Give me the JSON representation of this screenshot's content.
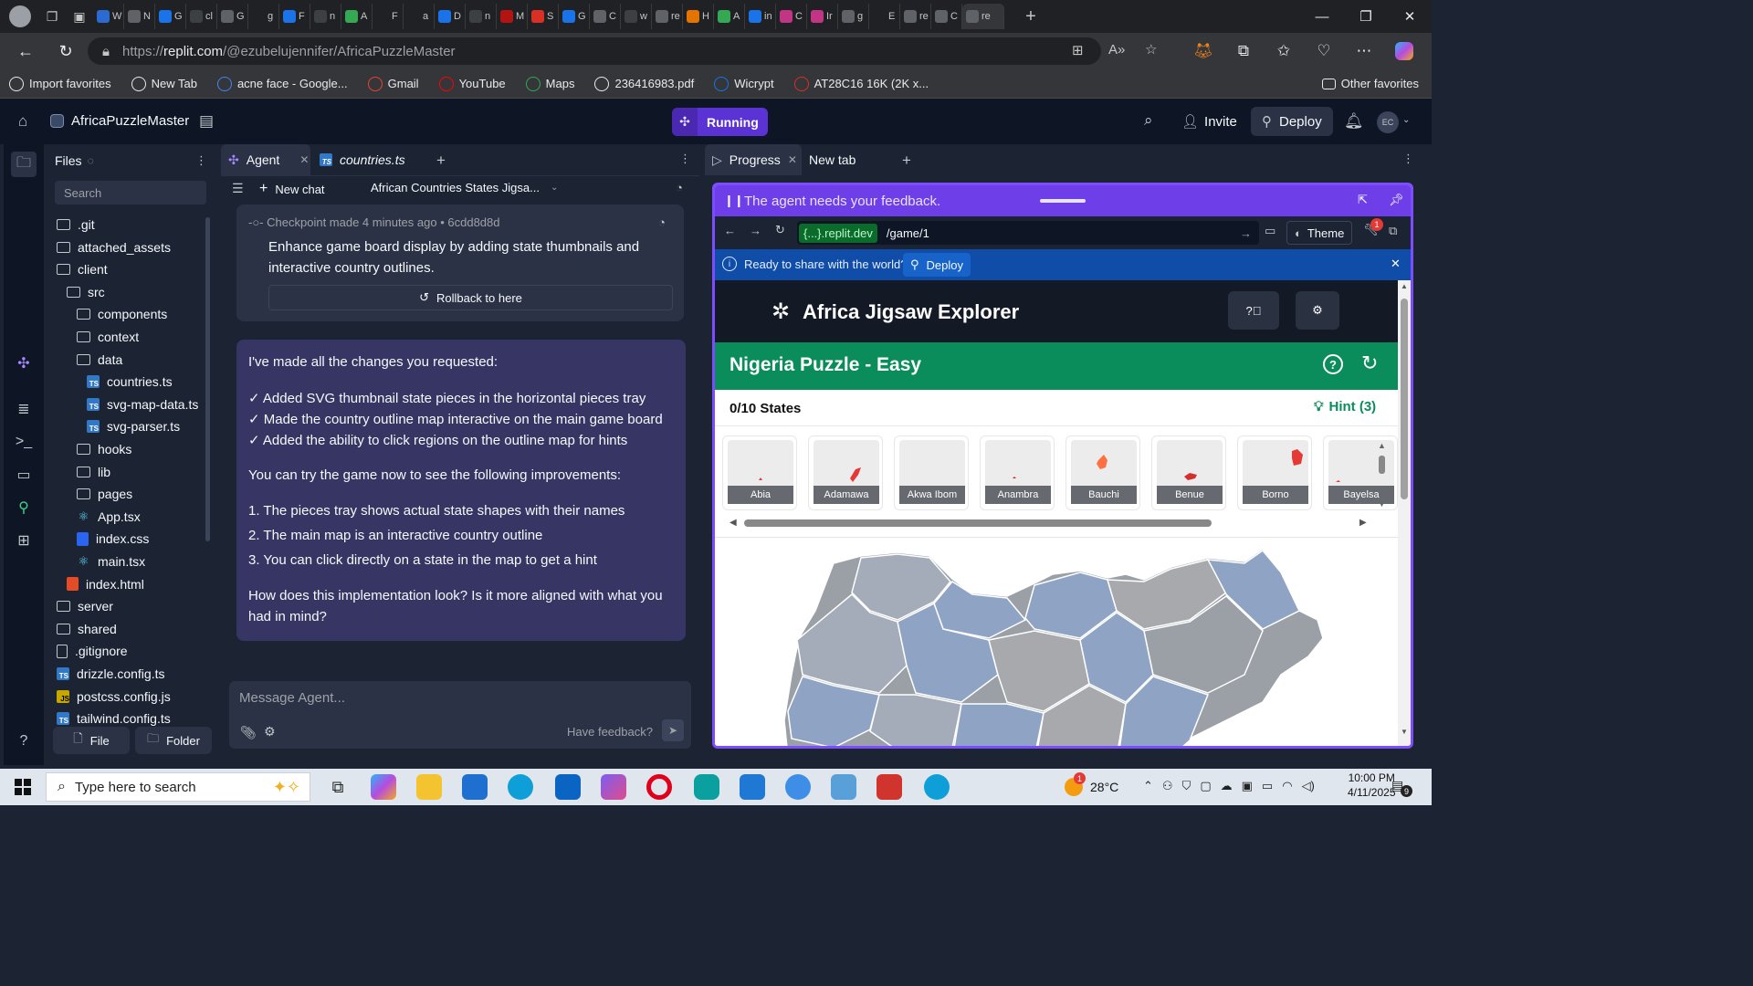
{
  "browser": {
    "tabs": [
      "W",
      "N",
      "G",
      "cl",
      "G",
      "g",
      "F",
      "n",
      "A",
      "F",
      "a",
      "D",
      "n",
      "M",
      "S",
      "G",
      "C",
      "w",
      "re",
      "H",
      "A",
      "in",
      "C",
      "Ir",
      "g",
      "E",
      "re",
      "C",
      "re"
    ],
    "url_prefix": "https://",
    "url_host": "replit.com",
    "url_path": "/@ezubelujennifer/AfricaPuzzleMaster",
    "bookmarks": [
      {
        "label": "Import favorites",
        "icon": "import-icon",
        "color": "#e8eaed"
      },
      {
        "label": "New Tab",
        "icon": "globe-icon",
        "color": "#e8eaed"
      },
      {
        "label": "acne face - Google...",
        "icon": "google-icon",
        "color": "#4285f4"
      },
      {
        "label": "Gmail",
        "icon": "gmail-icon",
        "color": "#ea4335"
      },
      {
        "label": "YouTube",
        "icon": "youtube-icon",
        "color": "#ff0000"
      },
      {
        "label": "Maps",
        "icon": "maps-icon",
        "color": "#34a853"
      },
      {
        "label": "236416983.pdf",
        "icon": "globe-icon",
        "color": "#e8eaed"
      },
      {
        "label": "Wicrypt",
        "icon": "wicrypt-icon",
        "color": "#1a73e8"
      },
      {
        "label": "AT28C16 16K (2K x...",
        "icon": "chip-icon",
        "color": "#d93025"
      }
    ],
    "other_favorites": "Other favorites"
  },
  "replit": {
    "project": "AfricaPuzzleMaster",
    "status": "Running",
    "invite": "Invite",
    "deploy": "Deploy",
    "avatar": "EC"
  },
  "files": {
    "title": "Files",
    "search_placeholder": "Search",
    "items": [
      {
        "name": ".git",
        "type": "folder",
        "depth": 0
      },
      {
        "name": "attached_assets",
        "type": "folder",
        "depth": 0
      },
      {
        "name": "client",
        "type": "folder-open",
        "depth": 0
      },
      {
        "name": "src",
        "type": "folder-open",
        "depth": 1
      },
      {
        "name": "components",
        "type": "folder",
        "depth": 2
      },
      {
        "name": "context",
        "type": "folder",
        "depth": 2
      },
      {
        "name": "data",
        "type": "folder-open",
        "depth": 2
      },
      {
        "name": "countries.ts",
        "type": "ts",
        "depth": 3
      },
      {
        "name": "svg-map-data.ts",
        "type": "ts",
        "depth": 3
      },
      {
        "name": "svg-parser.ts",
        "type": "ts",
        "depth": 3
      },
      {
        "name": "hooks",
        "type": "folder",
        "depth": 2
      },
      {
        "name": "lib",
        "type": "folder",
        "depth": 2
      },
      {
        "name": "pages",
        "type": "folder",
        "depth": 2
      },
      {
        "name": "App.tsx",
        "type": "react",
        "depth": 2
      },
      {
        "name": "index.css",
        "type": "css",
        "depth": 2
      },
      {
        "name": "main.tsx",
        "type": "react",
        "depth": 2
      },
      {
        "name": "index.html",
        "type": "html",
        "depth": 1
      },
      {
        "name": "server",
        "type": "folder",
        "depth": 0
      },
      {
        "name": "shared",
        "type": "folder",
        "depth": 0
      },
      {
        "name": ".gitignore",
        "type": "doc",
        "depth": 0
      },
      {
        "name": "drizzle.config.ts",
        "type": "ts",
        "depth": 0
      },
      {
        "name": "postcss.config.js",
        "type": "js",
        "depth": 0
      },
      {
        "name": "tailwind.config.ts",
        "type": "ts",
        "depth": 0
      }
    ],
    "new_file": "File",
    "new_folder": "Folder"
  },
  "agent": {
    "tab_agent": "Agent",
    "tab_file": "countries.ts",
    "new_chat": "New chat",
    "chat_title": "African Countries States Jigsa...",
    "checkpoint_label": "Checkpoint made 4 minutes ago",
    "checkpoint_hash": "6cdd8d8d",
    "checkpoint_msg_1": "Enhance game board display by adding state thumbnails and",
    "checkpoint_msg_2": "interactive country outlines.",
    "rollback": "Rollback to here",
    "message_lines": [
      "I've made all the changes you requested:",
      "✓ Added SVG thumbnail state pieces in the horizontal pieces tray",
      "✓ Made the country outline map interactive on the main game board",
      "✓ Added the ability to click regions on the outline map for hints",
      "You can try the game now to see the following improvements:",
      "1. The pieces tray shows actual state shapes with their names",
      "2. The main map is an interactive country outline",
      "3. You can click directly on a state in the map to get a hint",
      "How does this implementation look? Is it more aligned with what you",
      "had in mind?"
    ],
    "input_placeholder": "Message Agent...",
    "have_feedback": "Have feedback?"
  },
  "progress": {
    "tab_progress": "Progress",
    "tab_new": "New tab",
    "feedback_text": "The agent needs your feedback.",
    "webview_host": "{...}.replit.dev",
    "webview_path": "/game/1",
    "theme": "Theme",
    "badge": "1",
    "share_text": "Ready to share with the world?",
    "share_deploy": "Deploy"
  },
  "game": {
    "title": "Africa Jigsaw Explorer",
    "puzzle": "Nigeria Puzzle - Easy",
    "progress": "0/10 States",
    "hint": "Hint (3)",
    "pieces": [
      "Abia",
      "Adamawa",
      "Akwa Ibom",
      "Anambra",
      "Bauchi",
      "Benue",
      "Borno",
      "Bayelsa"
    ],
    "piece_colors": [
      "#e53935",
      "#e53935",
      "#9e9e9e",
      "#c62828",
      "#ff7043",
      "#d32f2f",
      "#e53935",
      "#e53935"
    ]
  },
  "taskbar": {
    "search_placeholder": "Type here to search",
    "weather": "28°C",
    "weather_badge": "1",
    "time": "10:00 PM",
    "date": "4/11/2025",
    "notification_count": "9"
  },
  "colors": {
    "replit_bg": "#0e1525",
    "panel_bg": "#1c2333",
    "running": "#5b33d4",
    "game_green": "#0a8d5b",
    "feedback_purple": "#6e3fe8",
    "share_blue": "#0f4da8"
  }
}
